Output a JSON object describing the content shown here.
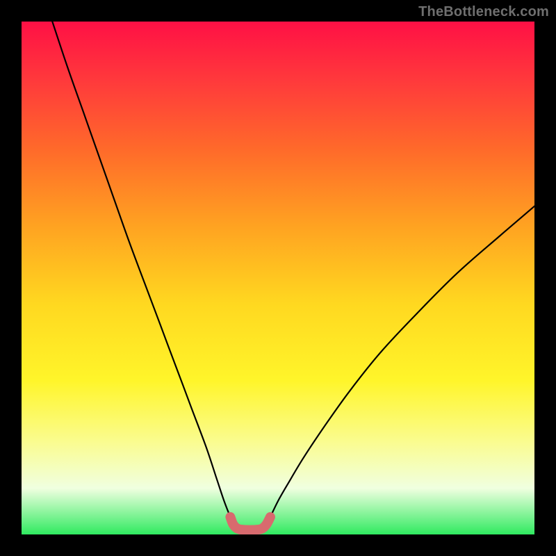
{
  "watermark": "TheBottleneck.com",
  "colors": {
    "frame": "#000000",
    "curve": "#000000",
    "thumb": "#d86a6e",
    "gradient_top": "#ff1045",
    "gradient_bottom": "#30ea60"
  },
  "chart_data": {
    "type": "line",
    "title": "",
    "xlabel": "",
    "ylabel": "",
    "xlim": [
      0,
      100
    ],
    "ylim": [
      0,
      100
    ],
    "series": [
      {
        "name": "left-curve",
        "x": [
          6,
          9,
          12,
          15,
          18,
          21,
          24,
          27,
          30,
          33,
          36,
          38,
          39.5,
          40.7
        ],
        "y": [
          100,
          91,
          82.5,
          74,
          65.5,
          57,
          49,
          41,
          33,
          25,
          17,
          11,
          6.5,
          3.4
        ]
      },
      {
        "name": "right-curve",
        "x": [
          48.5,
          50,
          52,
          55,
          59,
          64,
          70,
          77,
          85,
          93,
          100
        ],
        "y": [
          3.4,
          6.5,
          10,
          15,
          21,
          28,
          35.5,
          43,
          51,
          58,
          64
        ]
      },
      {
        "name": "valley-thumb",
        "x": [
          40.7,
          41.3,
          42.2,
          43.5,
          45.5,
          46.8,
          47.7,
          48.5
        ],
        "y": [
          3.4,
          1.9,
          1.1,
          0.9,
          0.9,
          1.1,
          1.9,
          3.4
        ]
      }
    ]
  }
}
